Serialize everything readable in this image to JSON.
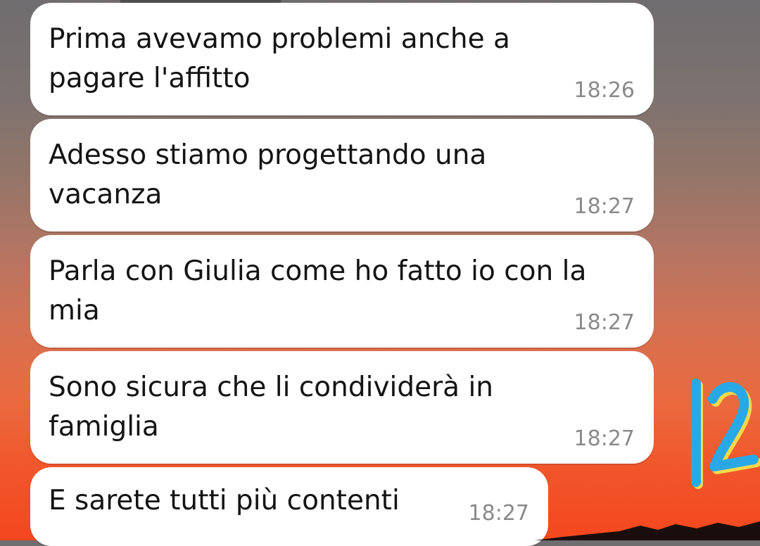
{
  "messages": [
    {
      "text": "Prima avevamo problemi anche a\npagare l'affitto",
      "time": "18:26"
    },
    {
      "text": "Adesso stiamo progettando una\nvacanza",
      "time": "18:27"
    },
    {
      "text": "Parla con Giulia come ho fatto io con la\nmia",
      "time": "18:27"
    },
    {
      "text": "Sono sicura che li condividerà in\nfamiglia",
      "time": "18:27"
    },
    {
      "text": "E sarete tutti più contenti",
      "time": "18:27"
    }
  ],
  "sticker": {
    "text": "12",
    "colors": [
      "#2aa8e6",
      "#f5d94a"
    ]
  },
  "colors": {
    "bubble": "#ffffff",
    "text": "#141414",
    "time": "#8a8a8a"
  }
}
